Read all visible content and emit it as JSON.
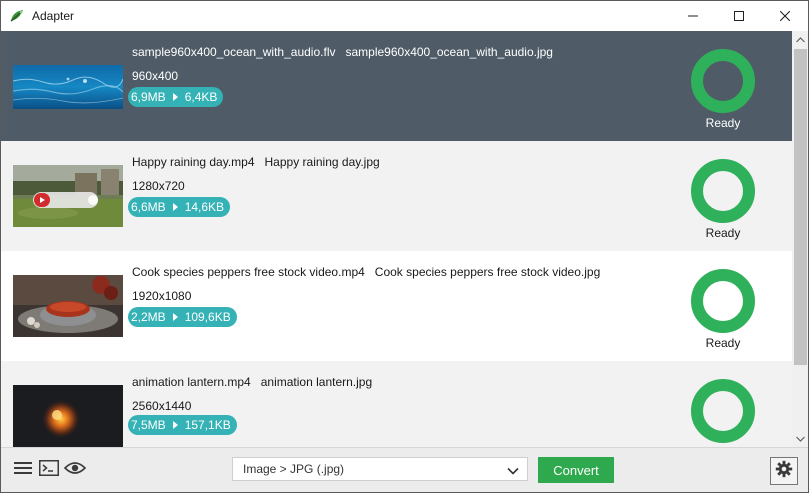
{
  "window": {
    "title": "Adapter"
  },
  "colors": {
    "selected_row": "#4f5b66",
    "status_ring": "#2fb05a",
    "size_pill": "#35b2b6",
    "convert_button": "#2fa94e"
  },
  "items": [
    {
      "source": "sample960x400_ocean_with_audio.flv",
      "output": "sample960x400_ocean_with_audio.jpg",
      "resolution": "960x400",
      "size_from": "6,9MB",
      "size_to": "6,4KB",
      "status": "Ready",
      "selected": true
    },
    {
      "source": "Happy raining day.mp4",
      "output": "Happy raining day.jpg",
      "resolution": "1280x720",
      "size_from": "6,6MB",
      "size_to": "14,6KB",
      "status": "Ready",
      "thumb_badge": "SUBSCRIBE"
    },
    {
      "source": "Cook species peppers free stock video.mp4",
      "output": "Cook species peppers free stock video.jpg",
      "resolution": "1920x1080",
      "size_from": "2,2MB",
      "size_to": "109,6KB",
      "status": "Ready"
    },
    {
      "source": "animation lantern.mp4",
      "output": "animation lantern.jpg",
      "resolution": "2560x1440",
      "size_from": "7,5MB",
      "size_to": "157,1KB",
      "status": ""
    }
  ],
  "toolbar": {
    "format_selected": "Image > JPG (.jpg)",
    "convert_label": "Convert",
    "icons": [
      "menu-icon",
      "console-icon",
      "eye-icon",
      "gear-icon"
    ]
  }
}
